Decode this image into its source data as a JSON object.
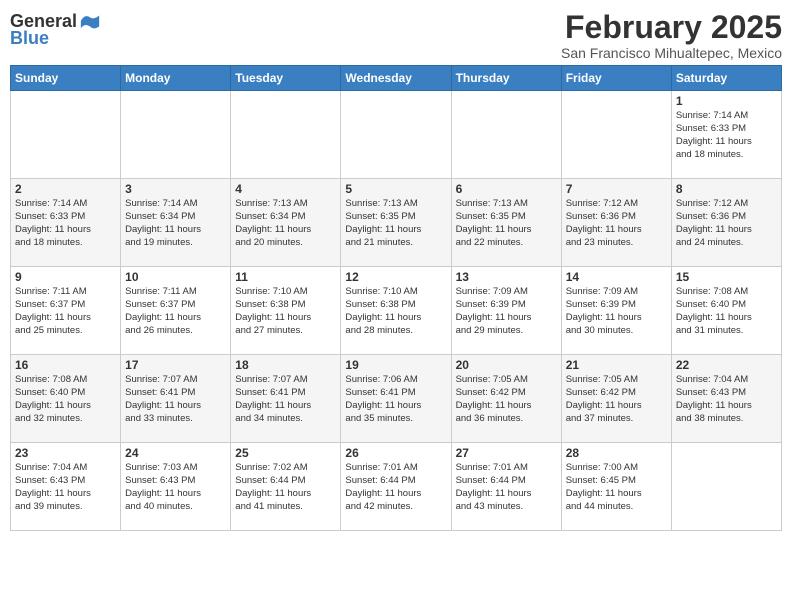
{
  "header": {
    "logo_general": "General",
    "logo_blue": "Blue",
    "month_title": "February 2025",
    "subtitle": "San Francisco Mihualtepec, Mexico"
  },
  "weekdays": [
    "Sunday",
    "Monday",
    "Tuesday",
    "Wednesday",
    "Thursday",
    "Friday",
    "Saturday"
  ],
  "weeks": [
    [
      {
        "day": "",
        "info": ""
      },
      {
        "day": "",
        "info": ""
      },
      {
        "day": "",
        "info": ""
      },
      {
        "day": "",
        "info": ""
      },
      {
        "day": "",
        "info": ""
      },
      {
        "day": "",
        "info": ""
      },
      {
        "day": "1",
        "info": "Sunrise: 7:14 AM\nSunset: 6:33 PM\nDaylight: 11 hours\nand 18 minutes."
      }
    ],
    [
      {
        "day": "2",
        "info": "Sunrise: 7:14 AM\nSunset: 6:33 PM\nDaylight: 11 hours\nand 18 minutes."
      },
      {
        "day": "3",
        "info": "Sunrise: 7:14 AM\nSunset: 6:34 PM\nDaylight: 11 hours\nand 19 minutes."
      },
      {
        "day": "4",
        "info": "Sunrise: 7:13 AM\nSunset: 6:34 PM\nDaylight: 11 hours\nand 20 minutes."
      },
      {
        "day": "5",
        "info": "Sunrise: 7:13 AM\nSunset: 6:35 PM\nDaylight: 11 hours\nand 21 minutes."
      },
      {
        "day": "6",
        "info": "Sunrise: 7:13 AM\nSunset: 6:35 PM\nDaylight: 11 hours\nand 22 minutes."
      },
      {
        "day": "7",
        "info": "Sunrise: 7:12 AM\nSunset: 6:36 PM\nDaylight: 11 hours\nand 23 minutes."
      },
      {
        "day": "8",
        "info": "Sunrise: 7:12 AM\nSunset: 6:36 PM\nDaylight: 11 hours\nand 24 minutes."
      }
    ],
    [
      {
        "day": "9",
        "info": "Sunrise: 7:11 AM\nSunset: 6:37 PM\nDaylight: 11 hours\nand 25 minutes."
      },
      {
        "day": "10",
        "info": "Sunrise: 7:11 AM\nSunset: 6:37 PM\nDaylight: 11 hours\nand 26 minutes."
      },
      {
        "day": "11",
        "info": "Sunrise: 7:10 AM\nSunset: 6:38 PM\nDaylight: 11 hours\nand 27 minutes."
      },
      {
        "day": "12",
        "info": "Sunrise: 7:10 AM\nSunset: 6:38 PM\nDaylight: 11 hours\nand 28 minutes."
      },
      {
        "day": "13",
        "info": "Sunrise: 7:09 AM\nSunset: 6:39 PM\nDaylight: 11 hours\nand 29 minutes."
      },
      {
        "day": "14",
        "info": "Sunrise: 7:09 AM\nSunset: 6:39 PM\nDaylight: 11 hours\nand 30 minutes."
      },
      {
        "day": "15",
        "info": "Sunrise: 7:08 AM\nSunset: 6:40 PM\nDaylight: 11 hours\nand 31 minutes."
      }
    ],
    [
      {
        "day": "16",
        "info": "Sunrise: 7:08 AM\nSunset: 6:40 PM\nDaylight: 11 hours\nand 32 minutes."
      },
      {
        "day": "17",
        "info": "Sunrise: 7:07 AM\nSunset: 6:41 PM\nDaylight: 11 hours\nand 33 minutes."
      },
      {
        "day": "18",
        "info": "Sunrise: 7:07 AM\nSunset: 6:41 PM\nDaylight: 11 hours\nand 34 minutes."
      },
      {
        "day": "19",
        "info": "Sunrise: 7:06 AM\nSunset: 6:41 PM\nDaylight: 11 hours\nand 35 minutes."
      },
      {
        "day": "20",
        "info": "Sunrise: 7:05 AM\nSunset: 6:42 PM\nDaylight: 11 hours\nand 36 minutes."
      },
      {
        "day": "21",
        "info": "Sunrise: 7:05 AM\nSunset: 6:42 PM\nDaylight: 11 hours\nand 37 minutes."
      },
      {
        "day": "22",
        "info": "Sunrise: 7:04 AM\nSunset: 6:43 PM\nDaylight: 11 hours\nand 38 minutes."
      }
    ],
    [
      {
        "day": "23",
        "info": "Sunrise: 7:04 AM\nSunset: 6:43 PM\nDaylight: 11 hours\nand 39 minutes."
      },
      {
        "day": "24",
        "info": "Sunrise: 7:03 AM\nSunset: 6:43 PM\nDaylight: 11 hours\nand 40 minutes."
      },
      {
        "day": "25",
        "info": "Sunrise: 7:02 AM\nSunset: 6:44 PM\nDaylight: 11 hours\nand 41 minutes."
      },
      {
        "day": "26",
        "info": "Sunrise: 7:01 AM\nSunset: 6:44 PM\nDaylight: 11 hours\nand 42 minutes."
      },
      {
        "day": "27",
        "info": "Sunrise: 7:01 AM\nSunset: 6:44 PM\nDaylight: 11 hours\nand 43 minutes."
      },
      {
        "day": "28",
        "info": "Sunrise: 7:00 AM\nSunset: 6:45 PM\nDaylight: 11 hours\nand 44 minutes."
      },
      {
        "day": "",
        "info": ""
      }
    ]
  ]
}
